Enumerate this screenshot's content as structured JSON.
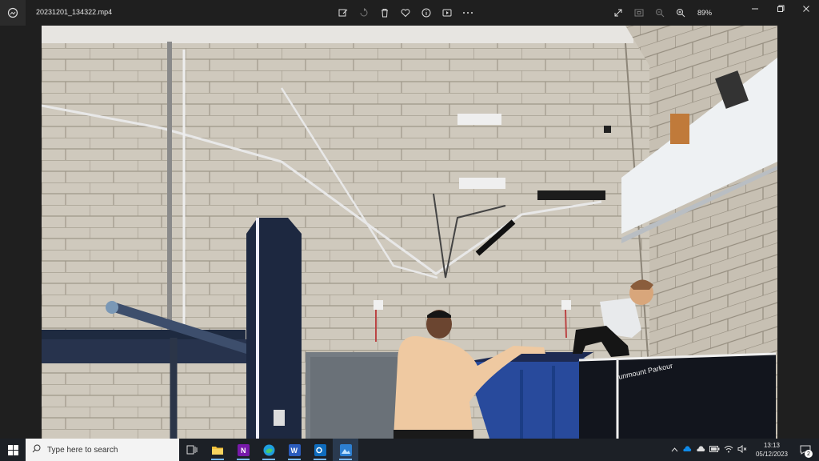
{
  "app": {
    "file_name": "20231201_134322.mp4",
    "zoom": "89%"
  },
  "toolbar": {
    "buttons": [
      "edit-icon",
      "rotate-icon",
      "delete-icon",
      "favorite-icon",
      "info-icon",
      "video-editor-icon",
      "more-icon"
    ],
    "right_buttons": [
      "fullscreen-icon",
      "fit-icon",
      "zoom-out-icon",
      "zoom-in-icon"
    ]
  },
  "window_controls": [
    "minimize-icon",
    "maximize-icon",
    "close-icon"
  ],
  "video": {
    "wall_sign": "unmount Parkour"
  },
  "taskbar": {
    "search_placeholder": "Type here to search",
    "apps": [
      "task-view-icon",
      "file-explorer-icon",
      "onenote-icon",
      "edge-icon",
      "word-icon",
      "outlook-icon",
      "photos-icon"
    ],
    "time": "13:13",
    "date": "05/12/2023",
    "notification_count": "2"
  },
  "colors": {
    "accent": "#77b7ff",
    "title_bg": "#1f1f1f",
    "taskbar_bg": "#1c2026"
  }
}
